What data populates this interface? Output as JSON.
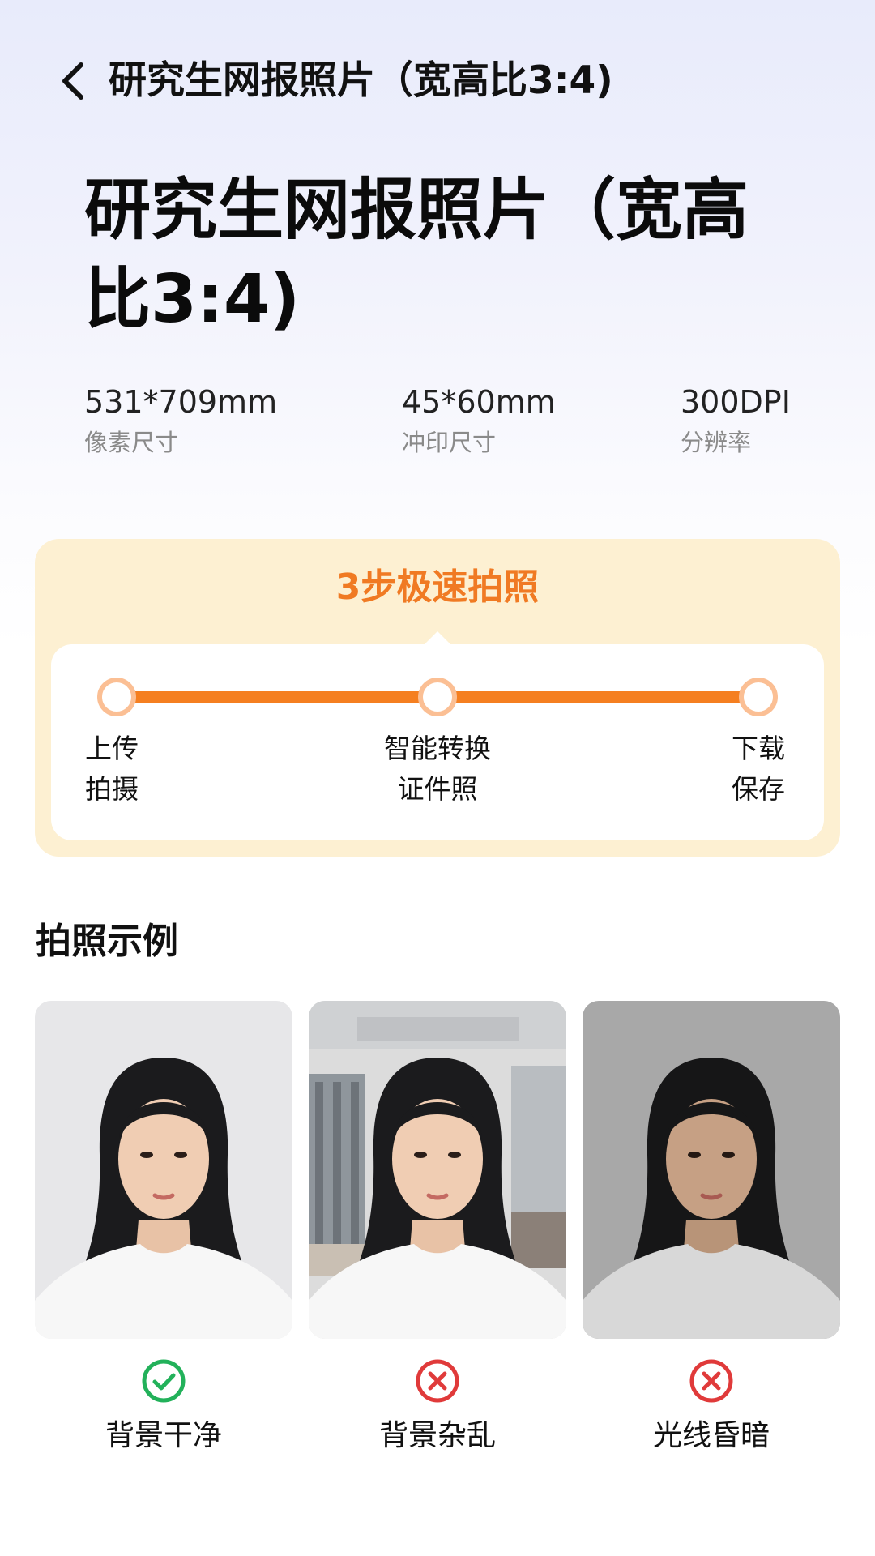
{
  "header": {
    "back_icon": "chevron-left-icon",
    "title": "研究生网报照片（宽高比3:4)"
  },
  "main_title": "研究生网报照片（宽高比3:4)",
  "specs": [
    {
      "value": "531*709mm",
      "label": "像素尺寸"
    },
    {
      "value": "45*60mm",
      "label": "冲印尺寸"
    },
    {
      "value": "300DPI",
      "label": "分辨率"
    }
  ],
  "steps": {
    "title": "3步极速拍照",
    "items": [
      {
        "line1": "上传",
        "line2": "拍摄"
      },
      {
        "line1": "智能转换",
        "line2": "证件照"
      },
      {
        "line1": "下载",
        "line2": "保存"
      }
    ],
    "accent": "#f57f20"
  },
  "examples": {
    "title": "拍照示例",
    "items": [
      {
        "label": "背景干净",
        "status": "correct",
        "icon": "check-circle-icon",
        "color": "#22b15a"
      },
      {
        "label": "背景杂乱",
        "status": "wrong",
        "icon": "x-circle-icon",
        "color": "#e03a3a"
      },
      {
        "label": "光线昏暗",
        "status": "wrong",
        "icon": "x-circle-icon",
        "color": "#e03a3a"
      }
    ]
  }
}
